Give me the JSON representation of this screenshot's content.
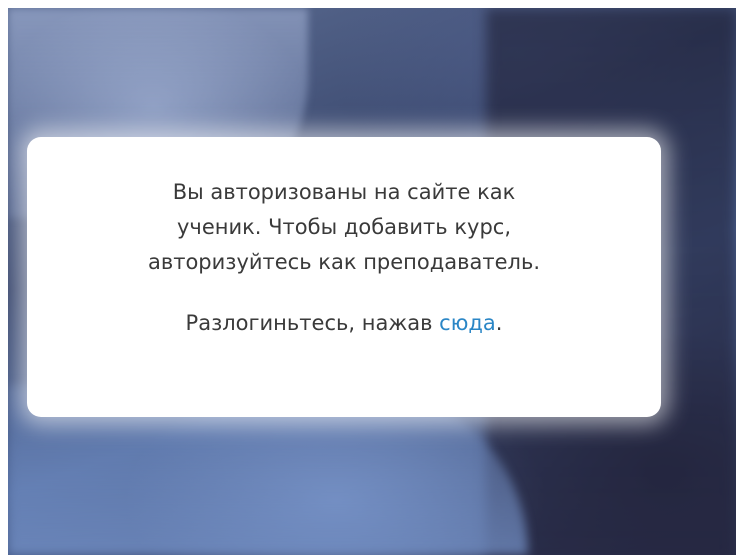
{
  "notice": {
    "line1": "Вы авторизованы на сайте как",
    "line2": "ученик. Чтобы добавить курс,",
    "line3": "авторизуйтесь как преподаватель.",
    "logout_prefix": "Разлогиньтесь, нажав ",
    "logout_link": "сюда",
    "logout_suffix": "."
  },
  "colors": {
    "link": "#2a86c6",
    "text": "#3a3a3a",
    "card_background": "#ffffff"
  }
}
